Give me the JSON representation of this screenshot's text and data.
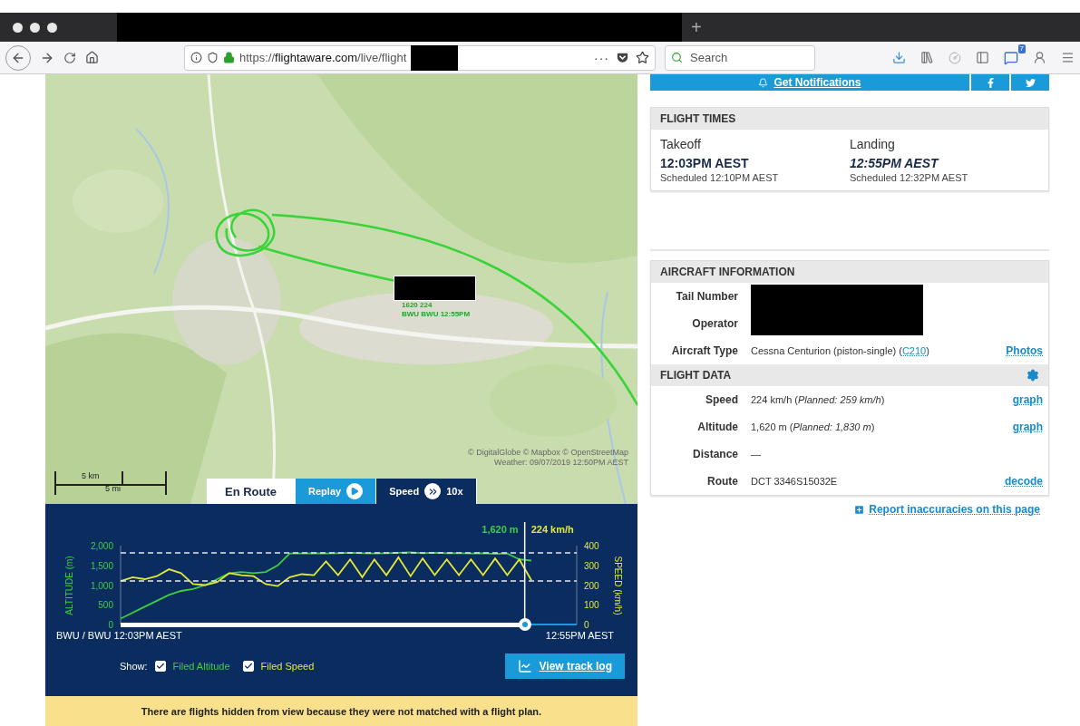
{
  "browser": {
    "new_tab": "+",
    "url_prefix": "https://",
    "url_domain": "flightaware.com",
    "url_path": "/live/flight",
    "more": "···",
    "search": {
      "placeholder": "Search"
    },
    "notification_badge": "7"
  },
  "notifications": {
    "label": "Get Notifications"
  },
  "map": {
    "flight_label": [
      "1620 224",
      "BWU BWU 12:55PM"
    ],
    "attribution": "© DigitalGlobe © Mapbox © OpenStreetMap",
    "weather": "Weather: 09/07/2019 12:50PM AEST",
    "scale": [
      "5 km",
      "5 mi"
    ]
  },
  "map_tabs": [
    {
      "label": "En Route",
      "kind": "plain",
      "selected": true
    },
    {
      "label": "Replay",
      "kind": "play",
      "selected": false
    },
    {
      "label": "Speed",
      "kind": "speed",
      "suffix": "10x",
      "selected": false
    }
  ],
  "track_panel": {
    "readout_altitude": "1,620 m",
    "readout_speed": "224 km/h",
    "level": 0.886,
    "altitude_chart": {
      "chart_data": {
        "type": "line",
        "ylabel": "ALTITUDE (m)",
        "categories": [
          null,
          null,
          null,
          null,
          null,
          null,
          null,
          null,
          null,
          null,
          null,
          null,
          null,
          null,
          null,
          null,
          null,
          null,
          null,
          null,
          null,
          null,
          null,
          null,
          null,
          null,
          null,
          null,
          null,
          null,
          null,
          null,
          null,
          null,
          null
        ],
        "ylim": [
          0,
          2000
        ],
        "yticks": [
          {
            "value": 0,
            "label": "0"
          },
          {
            "value": 500,
            "label": "500"
          },
          {
            "value": 1000,
            "label": "1,000"
          },
          {
            "value": 1500,
            "label": "1,500"
          },
          {
            "value": 2000,
            "label": "2,000"
          }
        ],
        "series": [
          {
            "color": "#3ecf3e",
            "values": [
              150,
              300,
              450,
              600,
              750,
              850,
              900,
              1000,
              1150,
              1300,
              1330,
              1300,
              1330,
              1500,
              1800,
              1800,
              1810,
              1800,
              1810,
              1820,
              1810,
              1800,
              1810,
              1820,
              1830,
              1810,
              1820,
              1810,
              1810,
              1800,
              1810,
              1790,
              1800,
              1650,
              1620
            ]
          }
        ]
      }
    },
    "speed_chart": {
      "chart_data": {
        "type": "line",
        "ylabel": "SPEED (km/h)",
        "categories": [
          null,
          null,
          null,
          null,
          null,
          null,
          null,
          null,
          null,
          null,
          null,
          null,
          null,
          null,
          null,
          null,
          null,
          null,
          null,
          null,
          null,
          null,
          null,
          null,
          null,
          null,
          null,
          null,
          null,
          null,
          null,
          null,
          null,
          null,
          null
        ],
        "ylim": [
          0,
          400
        ],
        "yticks": [
          {
            "value": 0,
            "label": "0"
          },
          {
            "value": 100,
            "label": "100"
          },
          {
            "value": 200,
            "label": "200"
          },
          {
            "value": 300,
            "label": "300"
          },
          {
            "value": 400,
            "label": "400"
          }
        ],
        "series": [
          {
            "color": "#e2e83a",
            "values": [
              220,
              240,
              230,
              245,
              280,
              260,
              205,
              200,
              215,
              260,
              250,
              245,
              205,
              195,
              240,
              255,
              250,
              320,
              250,
              330,
              240,
              330,
              250,
              340,
              245,
              335,
              250,
              330,
              250,
              330,
              250,
              335,
              250,
              330,
              224
            ]
          }
        ]
      }
    },
    "start": "BWU / BWU 12:03PM AEST",
    "end": "12:55PM AEST",
    "show_label": "Show:",
    "show": [
      {
        "label": "Filed Altitude",
        "checked": true,
        "color": "#3ecf3e"
      },
      {
        "label": "Filed Speed",
        "checked": true,
        "color": "#e2e83a"
      }
    ],
    "track_log_button": "View track log"
  },
  "banner": "There are flights hidden from view because they were not matched with a flight plan.",
  "flight_times": {
    "title": "FLIGHT TIMES",
    "columns": [
      {
        "label": "Takeoff",
        "time": "12:03PM AEST",
        "estimated": false,
        "scheduled": "Scheduled 12:10PM AEST"
      },
      {
        "label": "Landing",
        "time": "12:55PM AEST",
        "estimated": true,
        "scheduled": "Scheduled 12:32PM AEST"
      }
    ]
  },
  "aircraft": {
    "title": "AIRCRAFT INFORMATION",
    "rows": [
      {
        "label": "Tail Number",
        "kind": "redacted"
      },
      {
        "label": "Operator",
        "kind": "redacted"
      },
      {
        "label": "Aircraft Type",
        "kind": "type",
        "prefix": "Cessna Centurion (piston-single) (",
        "link": "C210",
        "suffix": ")",
        "action": "Photos"
      }
    ]
  },
  "flight_data": {
    "title": "FLIGHT DATA",
    "rows": [
      {
        "label": "Speed",
        "value": "224 km/h (*Planned: 259 km/h*)",
        "action": "graph"
      },
      {
        "label": "Altitude",
        "value": "1,620 m (*Planned: 1,830 m*)",
        "action": "graph"
      },
      {
        "label": "Distance",
        "value": "—"
      },
      {
        "label": "Route",
        "value": "DCT 3346S15032E",
        "action": "decode"
      }
    ]
  },
  "report_link": "Report inaccuracies on this page"
}
